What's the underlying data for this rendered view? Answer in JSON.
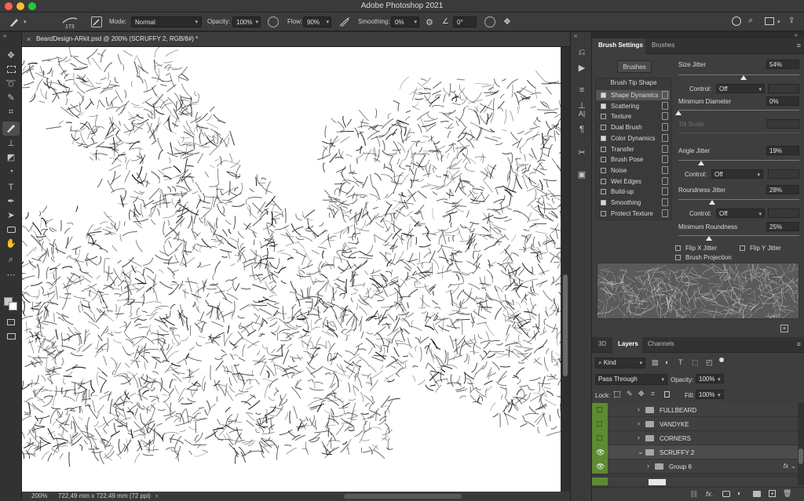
{
  "app": {
    "title": "Adobe Photoshop 2021"
  },
  "options_bar": {
    "brush_size": "173",
    "mode_label": "Mode:",
    "mode_value": "Normal",
    "opacity_label": "Opacity:",
    "opacity_value": "100%",
    "flow_label": "Flow:",
    "flow_value": "90%",
    "smoothing_label": "Smoothing:",
    "smoothing_value": "0%",
    "angle_value": "0°"
  },
  "document": {
    "tab_title": "BeardDesign-ARkit.psd @ 200% (SCRUFFY 2, RGB/8#) *"
  },
  "status": {
    "zoom": "200%",
    "info": "722,49 mm x 722,49 mm (72 ppi)"
  },
  "brush_panel": {
    "tabs": [
      "Brush Settings",
      "Brushes"
    ],
    "brushes_button": "Brushes",
    "tip_shape_label": "Brush Tip Shape",
    "options": [
      {
        "label": "Shape Dynamics",
        "checked": true
      },
      {
        "label": "Scattering",
        "checked": true
      },
      {
        "label": "Texture",
        "checked": false
      },
      {
        "label": "Dual Brush",
        "checked": false
      },
      {
        "label": "Color Dynamics",
        "checked": true
      },
      {
        "label": "Transfer",
        "checked": false
      },
      {
        "label": "Brush Pose",
        "checked": false
      },
      {
        "label": "Noise",
        "checked": false
      },
      {
        "label": "Wet Edges",
        "checked": false
      },
      {
        "label": "Build-up",
        "checked": false
      },
      {
        "label": "Smoothing",
        "checked": true
      },
      {
        "label": "Protect Texture",
        "checked": false
      }
    ],
    "size_jitter": {
      "label": "Size Jitter",
      "value": "54%",
      "level": 0.54
    },
    "control_label": "Control:",
    "control_value": "Off",
    "minimum_diameter": {
      "label": "Minimum Diameter",
      "value": "0%",
      "level": 0.0
    },
    "tilt_scale": {
      "label": "Tilt Scale"
    },
    "angle_jitter": {
      "label": "Angle Jitter",
      "value": "19%",
      "level": 0.19
    },
    "roundness_jitter": {
      "label": "Roundness Jitter",
      "value": "28%",
      "level": 0.28
    },
    "minimum_roundness": {
      "label": "Minimum Roundness",
      "value": "25%",
      "level": 0.25
    },
    "flip_x": "Flip X Jitter",
    "flip_y": "Flip Y Jitter",
    "brush_projection": "Brush Projection"
  },
  "layers_panel": {
    "tabs": [
      "3D",
      "Layers",
      "Channels"
    ],
    "filter_kind": "Kind",
    "blend_mode": "Pass Through",
    "opacity_label": "Opacity:",
    "opacity_value": "100%",
    "lock_label": "Lock:",
    "fill_label": "Fill:",
    "fill_value": "100%",
    "layers": [
      {
        "name": "FULLBEARD",
        "visible": false
      },
      {
        "name": "VANDYKE",
        "visible": false
      },
      {
        "name": "CORNERS",
        "visible": false
      },
      {
        "name": "SCRUFFY 2",
        "visible": true
      },
      {
        "name": "Group 6",
        "visible": true
      }
    ]
  }
}
